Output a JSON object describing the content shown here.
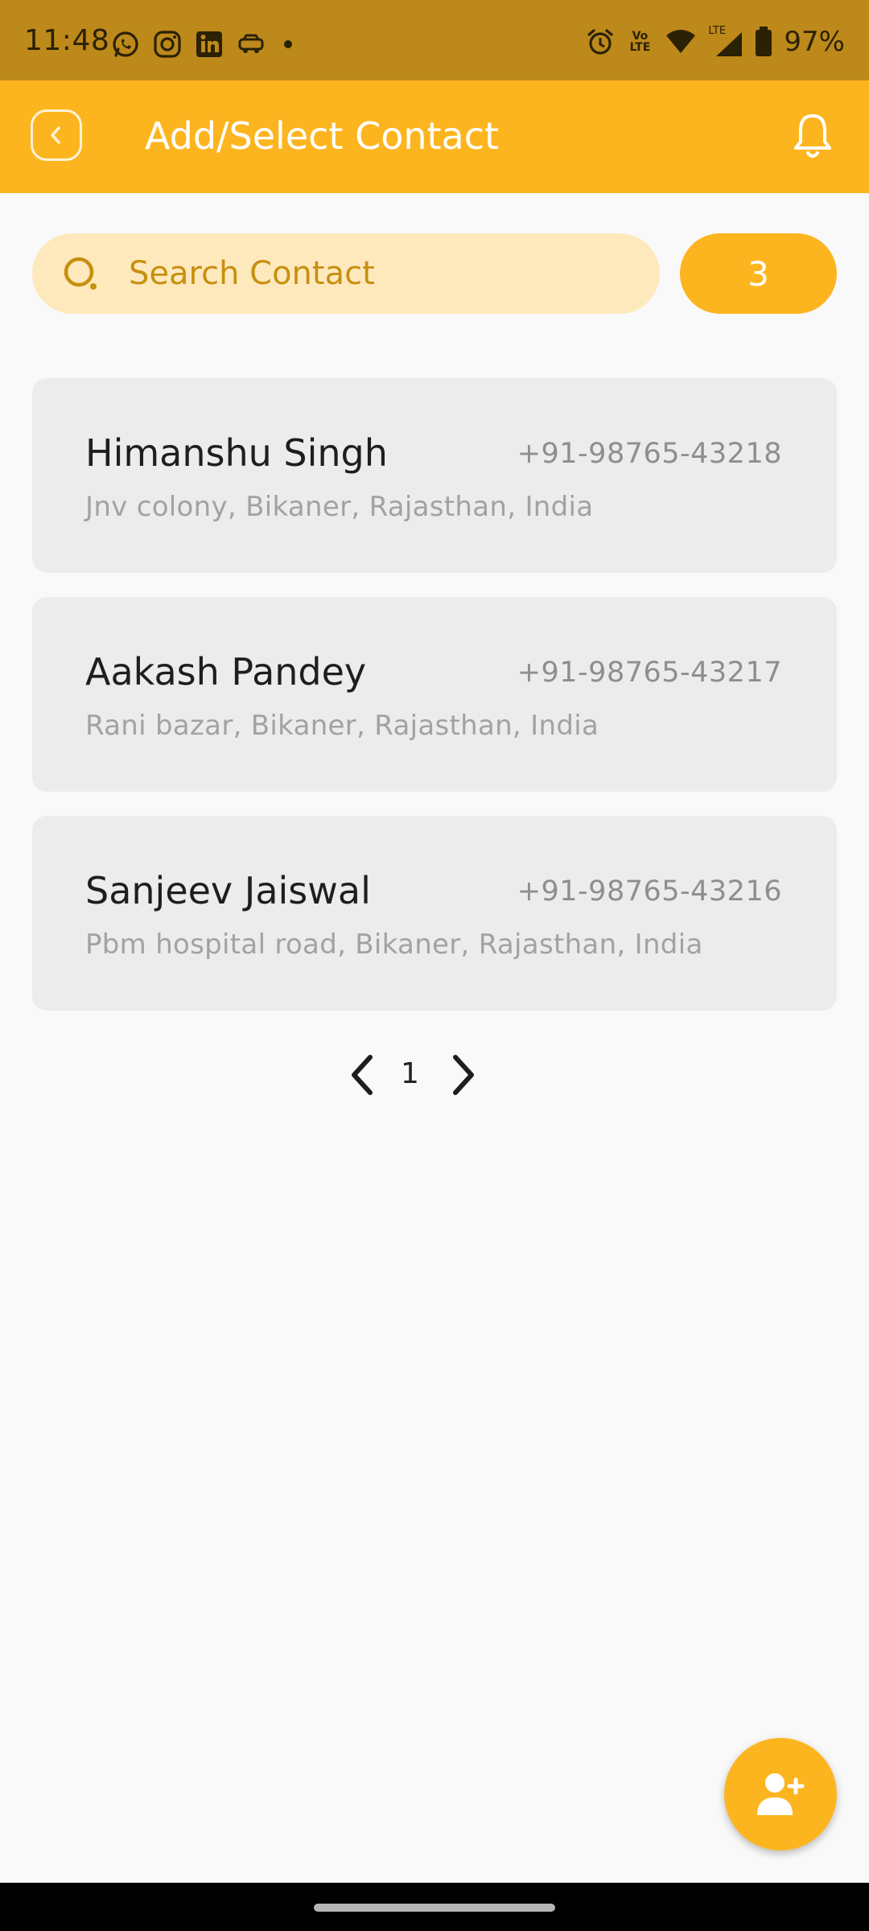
{
  "status_bar": {
    "time": "11:48",
    "battery": "97%",
    "left_icons": [
      "whatsapp-icon",
      "instagram-icon",
      "linkedin-icon",
      "car-icon",
      "dot-icon"
    ],
    "right_icons": [
      "alarm-icon",
      "volte-icon",
      "wifi-icon",
      "signal-icon",
      "battery-icon"
    ],
    "volte_label": "Vo LTE",
    "lte_label": "LTE"
  },
  "app_bar": {
    "title": "Add/Select Contact",
    "back_icon": "back-icon",
    "bell_icon": "bell-icon"
  },
  "search": {
    "placeholder": "Search Contact",
    "value": "",
    "count": "3"
  },
  "contacts": [
    {
      "name": "Himanshu Singh",
      "phone": "+91-98765-43218",
      "address": "Jnv colony, Bikaner, Rajasthan, India"
    },
    {
      "name": "Aakash Pandey",
      "phone": "+91-98765-43217",
      "address": "Rani bazar, Bikaner, Rajasthan, India"
    },
    {
      "name": "Sanjeev Jaiswal",
      "phone": "+91-98765-43216",
      "address": "Pbm hospital road, Bikaner, Rajasthan, India"
    }
  ],
  "pagination": {
    "current_page": "1"
  },
  "colors": {
    "accent": "#fdb51f",
    "status_bar": "#bc891a",
    "search_bg": "#fee9bd",
    "card_bg": "#ececec"
  }
}
